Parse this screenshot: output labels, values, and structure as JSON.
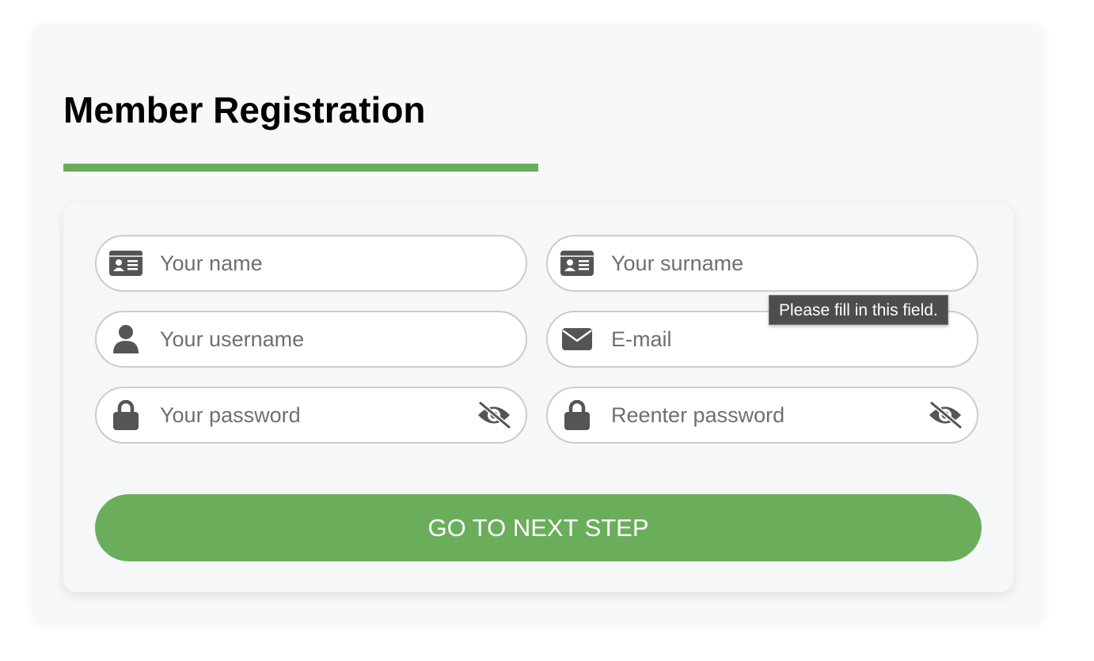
{
  "page": {
    "title": "Member Registration",
    "accent_color": "#6aae5c"
  },
  "form": {
    "fields": {
      "name": {
        "placeholder": "Your name",
        "value": "",
        "icon": "id-card-icon"
      },
      "surname": {
        "placeholder": "Your surname",
        "value": "",
        "icon": "id-card-icon"
      },
      "username": {
        "placeholder": "Your username",
        "value": "",
        "icon": "user-icon"
      },
      "email": {
        "placeholder": "E-mail",
        "value": "",
        "icon": "envelope-icon"
      },
      "password": {
        "placeholder": "Your password",
        "value": "",
        "icon": "lock-icon",
        "toggle_icon": "eye-slash-icon"
      },
      "password_confirm": {
        "placeholder": "Reenter password",
        "value": "",
        "icon": "lock-icon",
        "toggle_icon": "eye-slash-icon"
      }
    },
    "validation_tooltip": "Please fill in this field.",
    "submit_label": "GO TO NEXT STEP"
  }
}
